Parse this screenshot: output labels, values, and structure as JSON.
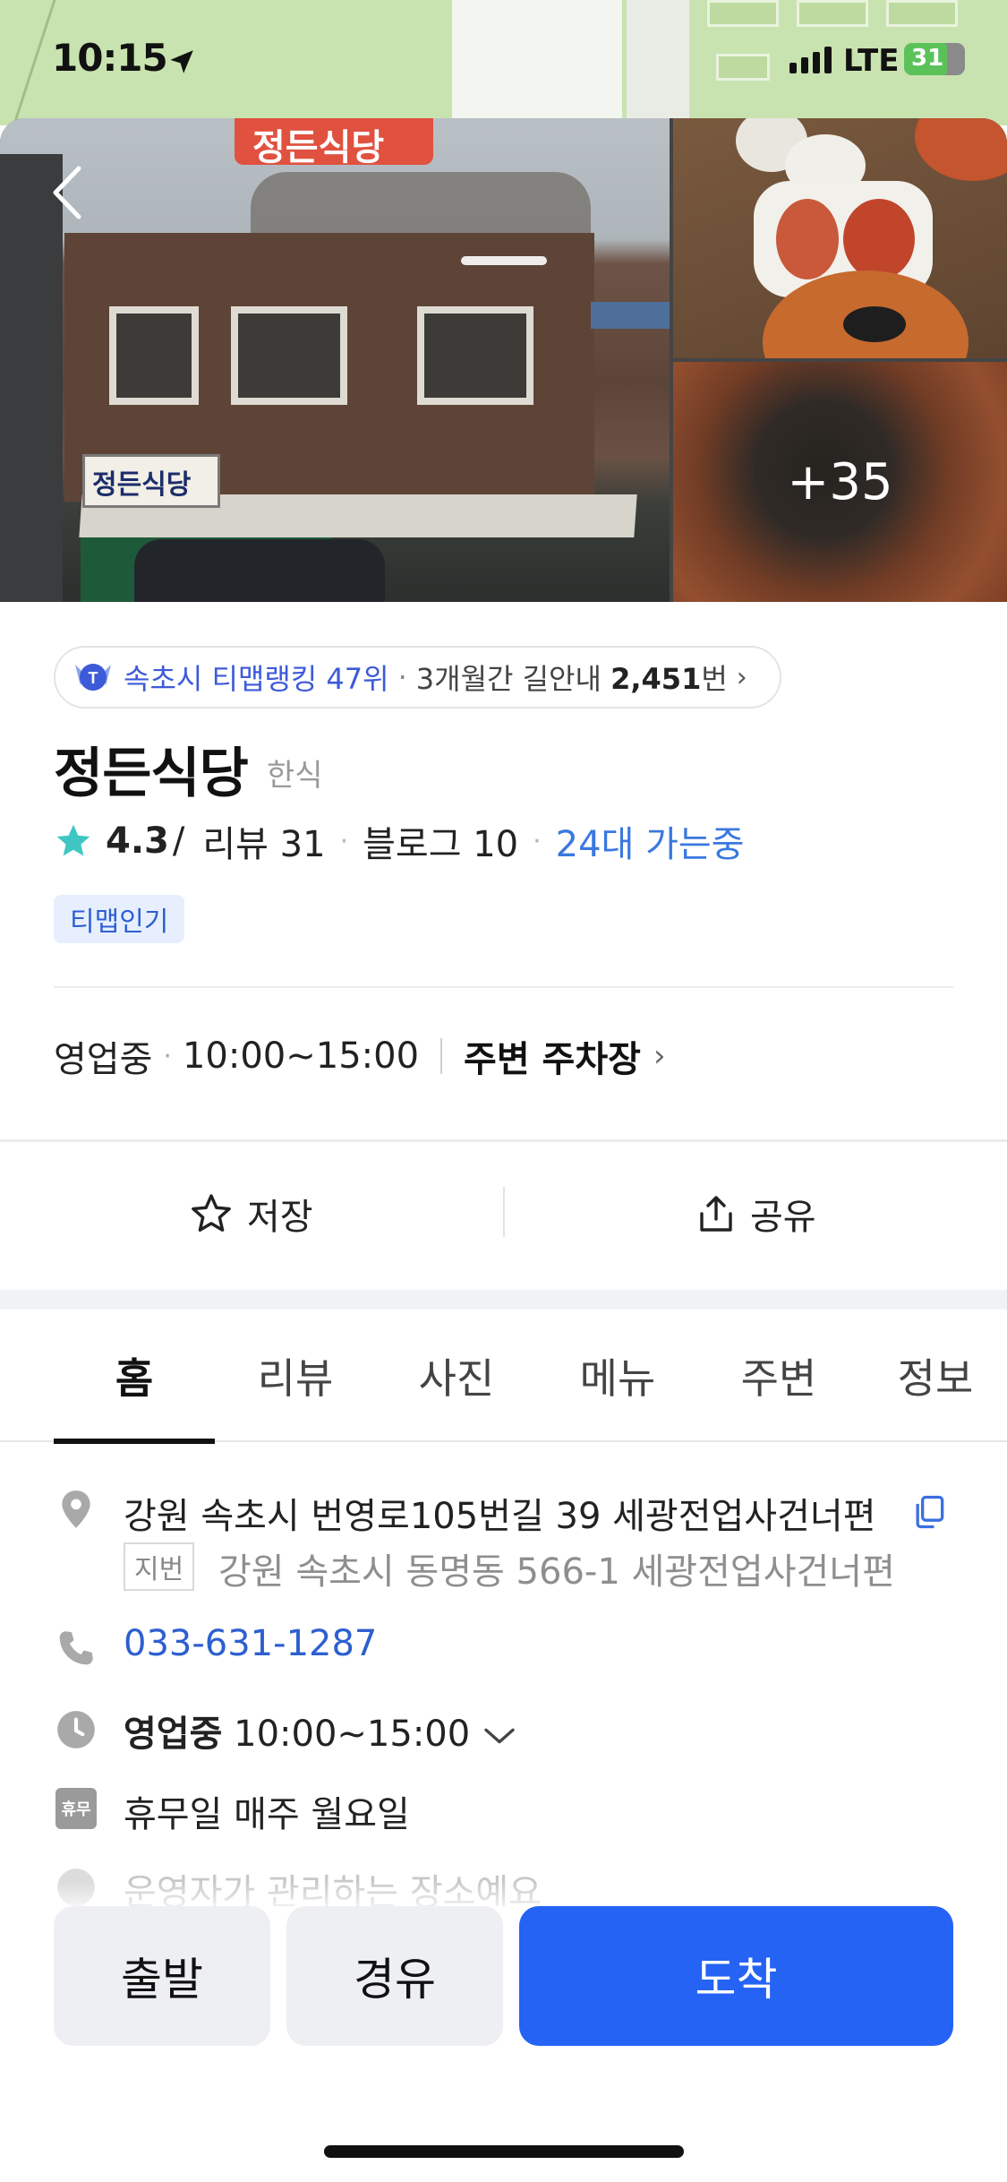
{
  "status_bar": {
    "time": "10:15",
    "network": "LTE",
    "battery": "31"
  },
  "gallery": {
    "photo_sign_text": "정든식당",
    "store_sign_text": "정든식당",
    "more_photos": "+35"
  },
  "ranking": {
    "rank_text": "속초시 티맵랭킹 47위",
    "separator": "·",
    "nav_prefix": "3개월간 길안내",
    "nav_count": "2,451",
    "nav_suffix": "번",
    "chevron": "›"
  },
  "place": {
    "name": "정든식당",
    "category": "한식",
    "rating": "4.3",
    "rating_suffix": "/",
    "reviews": "리뷰 31",
    "blogs": "블로그 10",
    "going": "24대 가는중",
    "badge": "티맵인기"
  },
  "hours_summary": {
    "status": "영업중",
    "hours": "10:00~15:00",
    "parking": "주변 주차장",
    "chevron": "›"
  },
  "actions": {
    "save": "저장",
    "share": "공유"
  },
  "tabs": [
    {
      "label": "홈"
    },
    {
      "label": "리뷰"
    },
    {
      "label": "사진"
    },
    {
      "label": "메뉴"
    },
    {
      "label": "주변"
    },
    {
      "label": "정보"
    }
  ],
  "details": {
    "address": "강원 속초시 번영로105번길 39 세광전업사건너편",
    "jibun_label": "지번",
    "jibun": "강원 속초시 동명동 566-1 세광전업사건너편",
    "phone": "033-631-1287",
    "open_status": "영업중",
    "open_hours": "10:00~15:00",
    "holiday_icon_text": "휴무",
    "closed_days": "휴무일 매주 월요일",
    "managed_note": "운영자가 관리하는 장소예요"
  },
  "bottom_buttons": {
    "start": "출발",
    "via": "경유",
    "destination": "도착"
  },
  "colors": {
    "accent_blue": "#2463f4",
    "link_blue": "#2d5fd0",
    "star_teal": "#3fc6c2"
  }
}
